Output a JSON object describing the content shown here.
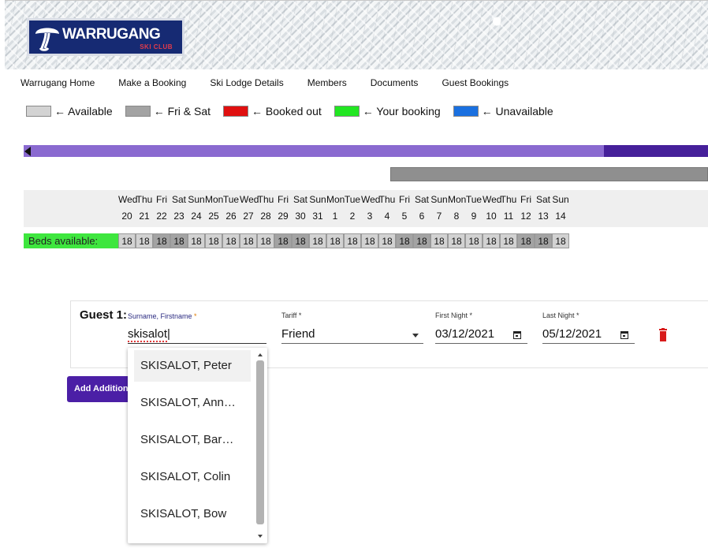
{
  "brand": {
    "name": "WARRUGANG",
    "sub": "SKI CLUB"
  },
  "nav": [
    "Warrugang Home",
    "Make a Booking",
    "Ski Lodge Details",
    "Members",
    "Documents",
    "Guest Bookings"
  ],
  "legend": [
    {
      "label": "← Available",
      "color": "#d3d3d3"
    },
    {
      "label": "← Fri & Sat",
      "color": "#a3a3a3"
    },
    {
      "label": "← Booked out",
      "color": "#e01010"
    },
    {
      "label": "← Your booking",
      "color": "#22e622"
    },
    {
      "label": "← Unavailable",
      "color": "#1a70e0"
    }
  ],
  "calendar": {
    "days": [
      "Wed",
      "Thu",
      "Fri",
      "Sat",
      "Sun",
      "Mon",
      "Tue",
      "Wed",
      "Thu",
      "Fri",
      "Sat",
      "Sun",
      "Mon",
      "Tue",
      "Wed",
      "Thu",
      "Fri",
      "Sat",
      "Sun",
      "Mon",
      "Tue",
      "Wed",
      "Thu",
      "Fri",
      "Sat",
      "Sun"
    ],
    "dates": [
      "20",
      "21",
      "22",
      "23",
      "24",
      "25",
      "26",
      "27",
      "28",
      "29",
      "30",
      "31",
      "1",
      "2",
      "3",
      "4",
      "5",
      "6",
      "7",
      "8",
      "9",
      "10",
      "11",
      "12",
      "13",
      "14"
    ],
    "beds_label": "Beds available:",
    "beds": [
      "18",
      "18",
      "18",
      "18",
      "18",
      "18",
      "18",
      "18",
      "18",
      "18",
      "18",
      "18",
      "18",
      "18",
      "18",
      "18",
      "18",
      "18",
      "18",
      "18",
      "18",
      "18",
      "18",
      "18",
      "18",
      "18"
    ]
  },
  "guest": {
    "label": "Guest 1:",
    "surname_label": "Surname, Firstname",
    "surname_value": "skisalot",
    "tariff_label": "Tariff",
    "tariff_value": "Friend",
    "first_label": "First Night",
    "first_value": "03/12/2021",
    "last_label": "Last Night",
    "last_value": "05/12/2021",
    "required_mark": "*"
  },
  "add_button": "Add Additional Guest",
  "suggestions": [
    "SKISALOT, Peter",
    "SKISALOT, Ann…",
    "SKISALOT, Bar…",
    "SKISALOT, Colin",
    "SKISALOT, Bow"
  ]
}
